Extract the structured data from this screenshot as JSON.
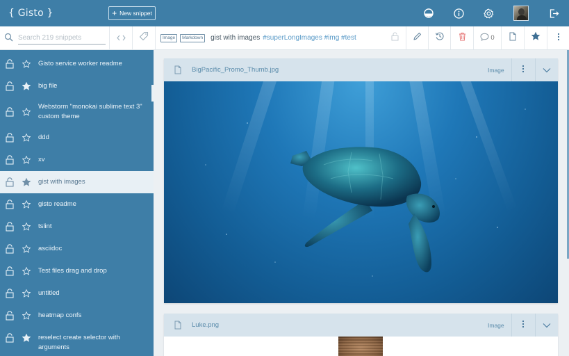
{
  "app": {
    "logo": "{ Gisto }"
  },
  "header": {
    "new_snippet_label": "New snippet",
    "icons": [
      "theme-icon",
      "info-icon",
      "settings-icon",
      "avatar",
      "logout-icon"
    ]
  },
  "toolbar": {
    "search_placeholder": "Search 219 snippets",
    "badges": [
      "Image",
      "Markdown"
    ],
    "title": "gist with images",
    "tags": "#superLongImages #img #test",
    "comment_count": "0"
  },
  "sidebar": {
    "items": [
      {
        "label": "Gisto service worker readme",
        "starred": false
      },
      {
        "label": "big file",
        "starred": true
      },
      {
        "label": "Webstorm \"monokai sublime text 3\" custom theme",
        "starred": false
      },
      {
        "label": "ddd",
        "starred": false
      },
      {
        "label": "xv",
        "starred": false
      },
      {
        "label": "gist with images",
        "starred": true,
        "active": true
      },
      {
        "label": "gisto readme",
        "starred": false
      },
      {
        "label": "tslint",
        "starred": false
      },
      {
        "label": "asciidoc",
        "starred": false
      },
      {
        "label": "Test files drag and drop",
        "starred": false
      },
      {
        "label": "untitled",
        "starred": false
      },
      {
        "label": "heatmap confs",
        "starred": false
      },
      {
        "label": "reselect create selector with arguments",
        "starred": true
      }
    ]
  },
  "files": [
    {
      "name": "BigPacific_Promo_Thumb.jpg",
      "type": "Image"
    },
    {
      "name": "Luke.png",
      "type": "Image"
    }
  ]
}
